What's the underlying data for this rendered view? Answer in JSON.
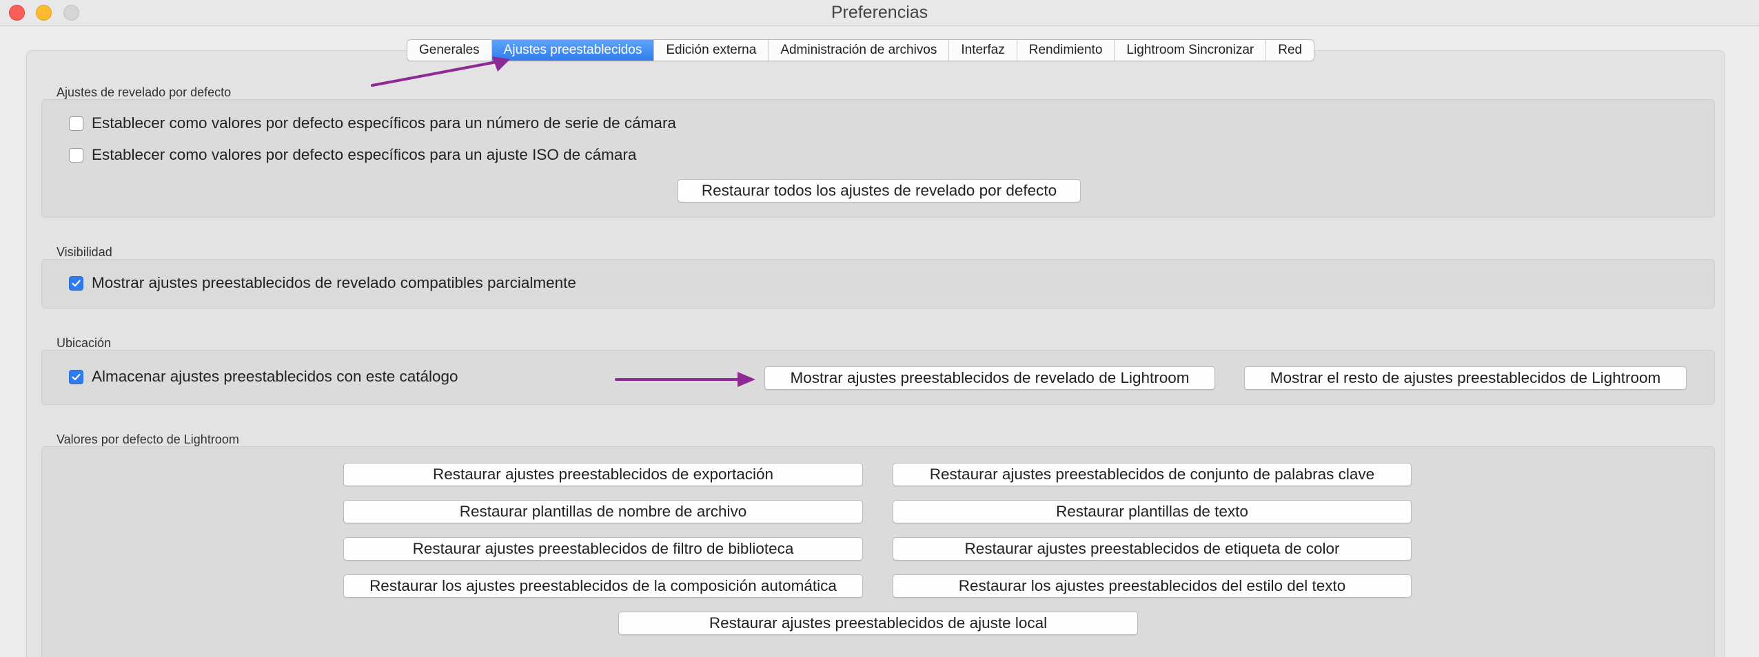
{
  "window": {
    "title": "Preferencias"
  },
  "tabs": [
    {
      "label": "Generales",
      "active": false
    },
    {
      "label": "Ajustes preestablecidos",
      "active": true
    },
    {
      "label": "Edición externa",
      "active": false
    },
    {
      "label": "Administración de archivos",
      "active": false
    },
    {
      "label": "Interfaz",
      "active": false
    },
    {
      "label": "Rendimiento",
      "active": false
    },
    {
      "label": "Lightroom Sincronizar",
      "active": false
    },
    {
      "label": "Red",
      "active": false
    }
  ],
  "develop_defaults": {
    "label": "Ajustes de revelado por defecto",
    "checkbox_serial": {
      "label": "Establecer como valores por defecto específicos para un número de serie de cámara",
      "checked": false
    },
    "checkbox_iso": {
      "label": "Establecer como valores por defecto específicos para un ajuste ISO de cámara",
      "checked": false
    },
    "reset_button": "Restaurar todos los ajustes de revelado por defecto"
  },
  "visibility": {
    "label": "Visibilidad",
    "checkbox_partial": {
      "label": "Mostrar ajustes preestablecidos de revelado compatibles parcialmente",
      "checked": true
    }
  },
  "location": {
    "label": "Ubicación",
    "checkbox_store": {
      "label": "Almacenar ajustes preestablecidos con este catálogo",
      "checked": true
    },
    "show_develop_button": "Mostrar ajustes preestablecidos de revelado de Lightroom",
    "show_other_button": "Mostrar el resto de ajustes preestablecidos de Lightroom"
  },
  "lightroom_defaults": {
    "label": "Valores por defecto de Lightroom",
    "buttons": [
      "Restaurar ajustes preestablecidos de exportación",
      "Restaurar ajustes preestablecidos de conjunto de palabras clave",
      "Restaurar plantillas de nombre de archivo",
      "Restaurar plantillas de texto",
      "Restaurar ajustes preestablecidos de filtro de biblioteca",
      "Restaurar ajustes preestablecidos de etiqueta de color",
      "Restaurar los ajustes preestablecidos de la composición automática",
      "Restaurar los ajustes preestablecidos del estilo del texto",
      "Restaurar ajustes preestablecidos de ajuste local"
    ]
  },
  "colors": {
    "accent": "#2f7cf0",
    "annotation_arrow": "#8e2a96"
  }
}
